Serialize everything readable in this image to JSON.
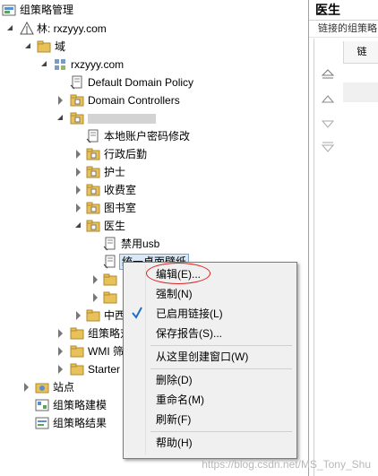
{
  "tree": {
    "root_label": "组策略管理",
    "forest_label": "林: rxzyyy.com",
    "domains_label": "域",
    "domain_label": "rxzyyy.com",
    "default_policy_label": "Default Domain Policy",
    "domain_controllers_label": "Domain Controllers",
    "blurred_ou_label": "",
    "local_password_label": "本地账户密码修改",
    "ou_admin_label": "行政后勤",
    "ou_nurse_label": "护士",
    "ou_fee_label": "收费室",
    "ou_library_label": "图书室",
    "ou_doctor_label": "医生",
    "gpo_usb_label": "禁用usb",
    "gpo_selected_label": "统一桌面壁纸",
    "ou_west_label": "中西",
    "gpo_objects_label": "组策略对",
    "wmi_label": "WMI 筛",
    "starter_label": "Starter",
    "sites_label": "站点",
    "modeling_label": "组策略建模",
    "results_label": "组策略结果"
  },
  "right": {
    "title": "医生",
    "subtitle": "链接的组策略",
    "col_header": "链"
  },
  "context_menu": {
    "edit": "编辑(E)...",
    "enforce": "强制(N)",
    "link_enabled": "已启用链接(L)",
    "save_report": "保存报告(S)...",
    "new_window": "从这里创建窗口(W)",
    "delete": "删除(D)",
    "rename": "重命名(M)",
    "refresh": "刷新(F)",
    "help": "帮助(H)"
  },
  "watermark": "https://blog.csdn.net/MS_Tony_Shu",
  "colors": {
    "folder": "#e8c15a",
    "selection": "#d9e8f7",
    "check": "#1e6ec8",
    "highlight_ellipse": "#e02020"
  }
}
